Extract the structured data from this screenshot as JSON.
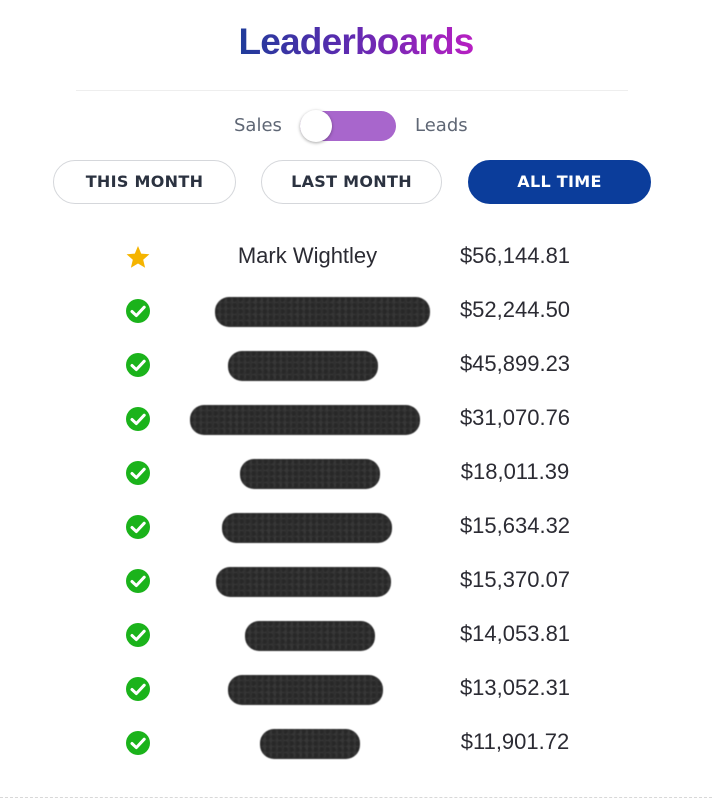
{
  "header": {
    "title": "Leaderboards"
  },
  "metric_toggle": {
    "left_label": "Sales",
    "right_label": "Leads",
    "selected": "Sales",
    "track_color": "#a866cc"
  },
  "range_tabs": {
    "items": [
      {
        "label": "THIS MONTH",
        "active": false
      },
      {
        "label": "LAST MONTH",
        "active": false
      },
      {
        "label": "ALL TIME",
        "active": true
      }
    ],
    "active_color": "#0b3d9b"
  },
  "leaderboard": {
    "rows": [
      {
        "rank": 1,
        "icon": "star-icon",
        "name": "Mark Wightley",
        "name_redacted": false,
        "amount": "$56,144.81"
      },
      {
        "rank": 2,
        "icon": "check-circle-icon",
        "name": "",
        "name_redacted": true,
        "amount": "$52,244.50"
      },
      {
        "rank": 3,
        "icon": "check-circle-icon",
        "name": "",
        "name_redacted": true,
        "amount": "$45,899.23"
      },
      {
        "rank": 4,
        "icon": "check-circle-icon",
        "name": "",
        "name_redacted": true,
        "amount": "$31,070.76"
      },
      {
        "rank": 5,
        "icon": "check-circle-icon",
        "name": "",
        "name_redacted": true,
        "amount": "$18,011.39"
      },
      {
        "rank": 6,
        "icon": "check-circle-icon",
        "name": "",
        "name_redacted": true,
        "amount": "$15,634.32"
      },
      {
        "rank": 7,
        "icon": "check-circle-icon",
        "name": "",
        "name_redacted": true,
        "amount": "$15,370.07"
      },
      {
        "rank": 8,
        "icon": "check-circle-icon",
        "name": "",
        "name_redacted": true,
        "amount": "$14,053.81"
      },
      {
        "rank": 9,
        "icon": "check-circle-icon",
        "name": "",
        "name_redacted": true,
        "amount": "$13,052.31"
      },
      {
        "rank": 10,
        "icon": "check-circle-icon",
        "name": "",
        "name_redacted": true,
        "amount": "$11,901.72"
      }
    ],
    "star_color": "#f5b400",
    "check_color": "#1bb31b"
  }
}
